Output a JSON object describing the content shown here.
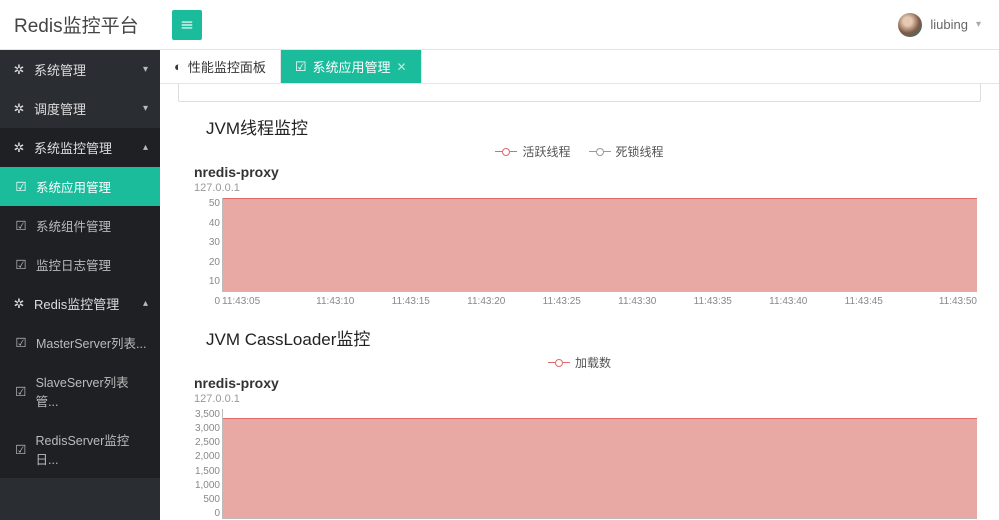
{
  "app_title": "Redis监控平台",
  "user": {
    "name": "liubing"
  },
  "sidebar": {
    "groups": [
      {
        "label": "系统管理",
        "icon": "⚙",
        "expanded": false,
        "items": []
      },
      {
        "label": "调度管理",
        "icon": "⚙",
        "expanded": false,
        "items": []
      },
      {
        "label": "系统监控管理",
        "icon": "⚙",
        "expanded": true,
        "items": [
          {
            "label": "系统应用管理",
            "icon": "☑",
            "active": true
          },
          {
            "label": "系统组件管理",
            "icon": "☑",
            "active": false
          },
          {
            "label": "监控日志管理",
            "icon": "☑",
            "active": false
          }
        ]
      },
      {
        "label": "Redis监控管理",
        "icon": "⚙",
        "expanded": true,
        "items": [
          {
            "label": "MasterServer列表...",
            "icon": "☑",
            "active": false
          },
          {
            "label": "SlaveServer列表管...",
            "icon": "☑",
            "active": false
          },
          {
            "label": "RedisServer监控日...",
            "icon": "☑",
            "active": false
          }
        ]
      }
    ]
  },
  "tabs": [
    {
      "label": "性能监控面板",
      "icon": "dashboard",
      "active": false,
      "closable": false
    },
    {
      "label": "系统应用管理",
      "icon": "check",
      "active": true,
      "closable": true
    }
  ],
  "charts": [
    {
      "section_title": "JVM线程监控",
      "series_title": "nredis-proxy",
      "host": "127.0.0.1",
      "legend": [
        "活跃线程",
        "死锁线程"
      ]
    },
    {
      "section_title": "JVM CassLoader监控",
      "series_title": "nredis-proxy",
      "host": "127.0.0.1",
      "legend": [
        "加载数"
      ]
    }
  ],
  "chart_data": [
    {
      "type": "area",
      "title": "JVM线程监控 — nredis-proxy",
      "ylabel": "",
      "ylim": [
        0,
        50
      ],
      "y_ticks": [
        0,
        10,
        20,
        30,
        40,
        50
      ],
      "x_ticks": [
        "11:43:05",
        "11:43:10",
        "11:43:15",
        "11:43:20",
        "11:43:25",
        "11:43:30",
        "11:43:35",
        "11:43:40",
        "11:43:45",
        "11:43:50"
      ],
      "series": [
        {
          "name": "活跃线程",
          "color": "#dc6b69",
          "values": [
            50,
            50,
            50,
            50,
            50,
            50,
            50,
            50,
            50,
            50
          ]
        },
        {
          "name": "死锁线程",
          "color": "#999999",
          "values": [
            0,
            0,
            0,
            0,
            0,
            0,
            0,
            0,
            0,
            0
          ]
        }
      ]
    },
    {
      "type": "area",
      "title": "JVM CassLoader监控 — nredis-proxy",
      "ylabel": "",
      "ylim": [
        0,
        3500
      ],
      "y_ticks": [
        0,
        500,
        1000,
        1500,
        2000,
        2500,
        3000,
        3500
      ],
      "series": [
        {
          "name": "加载数",
          "color": "#dc6b69",
          "values": [
            3200,
            3200,
            3200,
            3200,
            3200,
            3200,
            3200,
            3200,
            3200,
            3200
          ]
        }
      ]
    }
  ]
}
